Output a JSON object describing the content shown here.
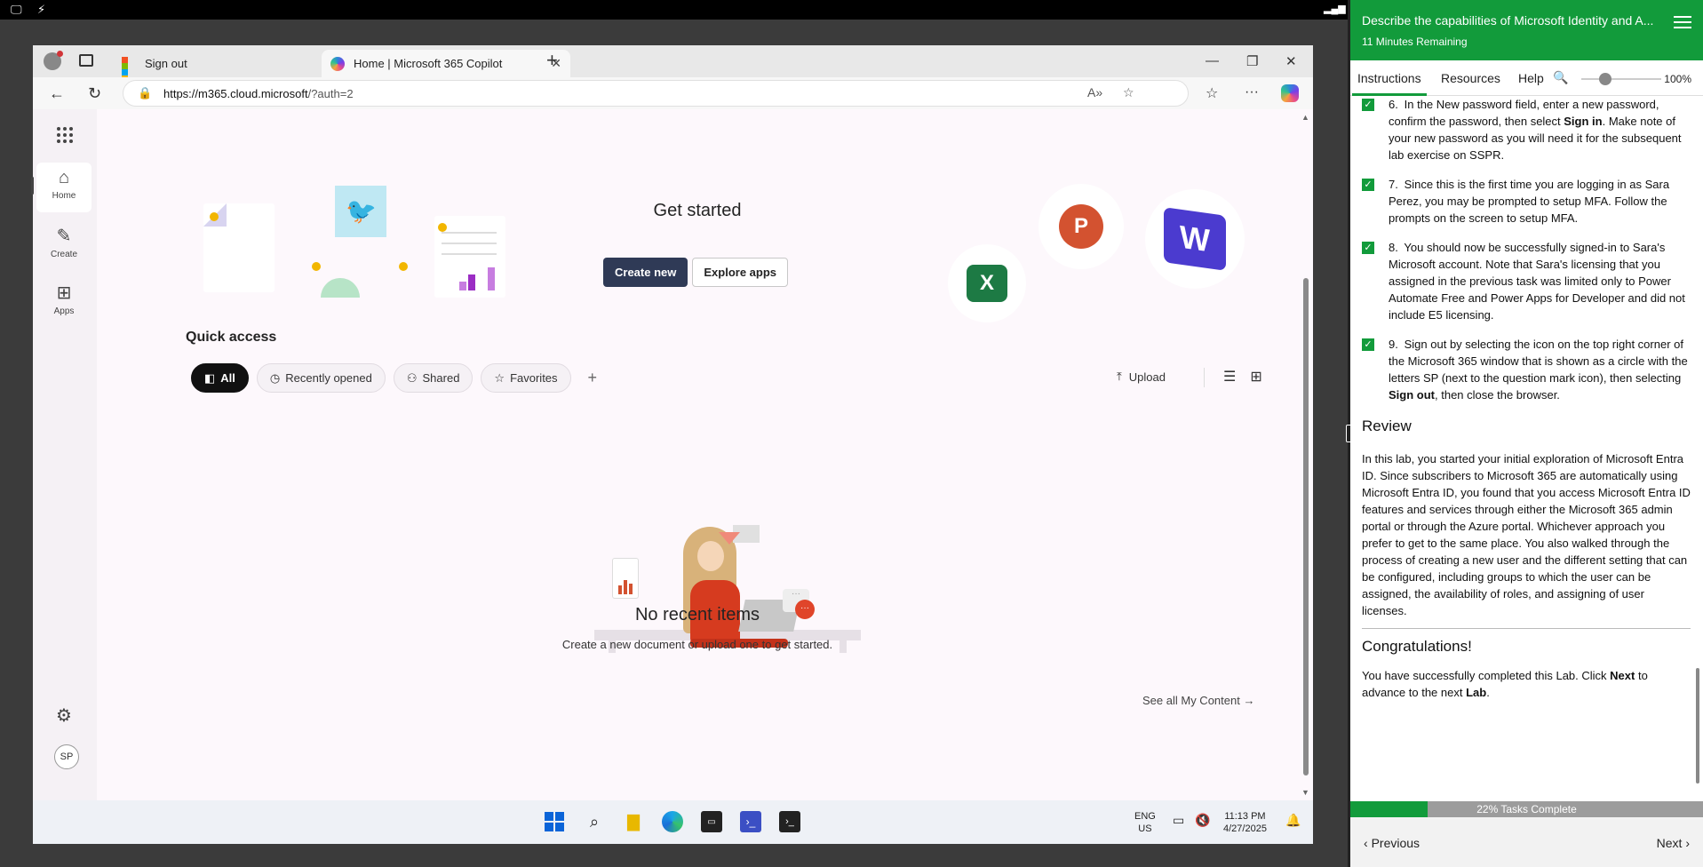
{
  "browser": {
    "tabs": [
      {
        "label": "Sign out"
      },
      {
        "label": "Home | Microsoft 365 Copilot"
      }
    ],
    "url_host": "https://m365.cloud.microsoft",
    "url_path": "/?auth=2"
  },
  "rail": {
    "items": [
      {
        "label": "Home",
        "icon": "home-icon"
      },
      {
        "label": "Create",
        "icon": "pencil-icon"
      },
      {
        "label": "Apps",
        "icon": "apps-icon"
      }
    ],
    "avatar": "SP"
  },
  "main": {
    "get_started": "Get started",
    "create_new": "Create new",
    "explore_apps": "Explore apps",
    "quick_access": "Quick access",
    "chips": [
      "All",
      "Recently opened",
      "Shared",
      "Favorites"
    ],
    "upload": "Upload",
    "no_recent_title": "No recent items",
    "no_recent_sub": "Create a new document or upload one to get started.",
    "see_all": "See all My Content"
  },
  "taskbar": {
    "lang1": "ENG",
    "lang2": "US",
    "time": "11:13 PM",
    "date": "4/27/2025"
  },
  "panel": {
    "title": "Describe the capabilities of Microsoft Identity and A...",
    "time_remaining": "11 Minutes Remaining",
    "tabs": [
      "Instructions",
      "Resources",
      "Help"
    ],
    "zoom": "100%",
    "steps": [
      {
        "num": "6.",
        "pre": "In the New password field, enter a new password, confirm the password, then select ",
        "bold": "Sign in",
        "post": ". Make note of your new password as you will need it for the subsequent lab exercise on SSPR."
      },
      {
        "num": "7.",
        "pre": "Since this is the first time you are logging in as Sara Perez, you may be prompted to setup MFA. Follow the prompts on the screen to setup MFA.",
        "bold": "",
        "post": ""
      },
      {
        "num": "8.",
        "pre": "You should now be successfully signed-in to Sara's Microsoft account. Note that Sara's licensing that you assigned in the previous task was limited only to Power Automate Free and Power Apps for Developer and did not include E5 licensing.",
        "bold": "",
        "post": ""
      },
      {
        "num": "9.",
        "pre": "Sign out by selecting the icon on the top right corner of the Microsoft 365 window that is shown as a circle with the letters SP (next to the question mark icon), then selecting ",
        "bold": "Sign out",
        "post": ", then close the browser."
      }
    ],
    "review_heading": "Review",
    "review_text": "In this lab, you started your initial exploration of Microsoft Entra ID. Since subscribers to Microsoft 365 are automatically using Microsoft Entra ID, you found that you access Microsoft Entra ID features and services through either the Microsoft 365 admin portal or through the Azure portal. Whichever approach you prefer to get to the same place. You also walked through the process of creating a new user and the different setting that can be configured, including groups to which the user can be assigned, the availability of roles, and assigning of user licenses.",
    "congrats_heading": "Congratulations!",
    "congrats_pre": "You have successfully completed this Lab. Click ",
    "congrats_bold1": "Next",
    "congrats_mid": " to advance to the next ",
    "congrats_bold2": "Lab",
    "congrats_post": ".",
    "progress_pct": 22,
    "progress_label": "22% Tasks Complete",
    "prev": "Previous",
    "next": "Next"
  },
  "colors": {
    "accent_green": "#129b3b",
    "create_btn": "#2f3a56"
  }
}
